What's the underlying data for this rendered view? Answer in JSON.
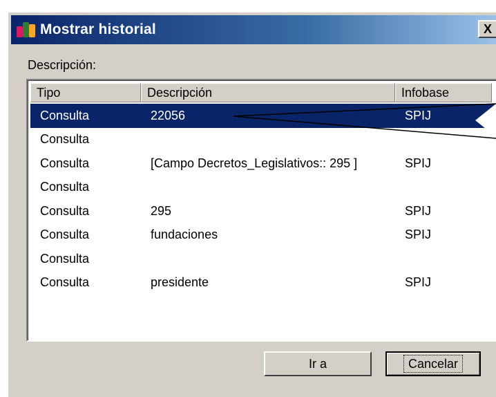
{
  "window": {
    "title": "Mostrar historial",
    "close_glyph": "X",
    "app_icon": "app-logo-icon"
  },
  "label": {
    "description": "Descripción:"
  },
  "list": {
    "columns": [
      "Tipo",
      "Descripción",
      "Infobase"
    ],
    "rows": [
      {
        "tipo": "Consulta",
        "descripcion": "22056",
        "infobase": "SPIJ",
        "selected": true
      },
      {
        "tipo": "Consulta",
        "descripcion": "",
        "infobase": ""
      },
      {
        "tipo": "Consulta",
        "descripcion": "[Campo Decretos_Legislativos:: 295 ]",
        "infobase": "SPIJ"
      },
      {
        "tipo": "Consulta",
        "descripcion": "",
        "infobase": ""
      },
      {
        "tipo": "Consulta",
        "descripcion": "295",
        "infobase": "SPIJ"
      },
      {
        "tipo": "Consulta",
        "descripcion": "fundaciones",
        "infobase": "SPIJ"
      },
      {
        "tipo": "Consulta",
        "descripcion": "",
        "infobase": ""
      },
      {
        "tipo": "Consulta",
        "descripcion": "presidente",
        "infobase": "SPIJ"
      }
    ]
  },
  "buttons": {
    "go": "Ir a",
    "cancel": "Cancelar"
  },
  "colors": {
    "selection": "#0a246a",
    "dialog_face": "#d4d0c8"
  }
}
